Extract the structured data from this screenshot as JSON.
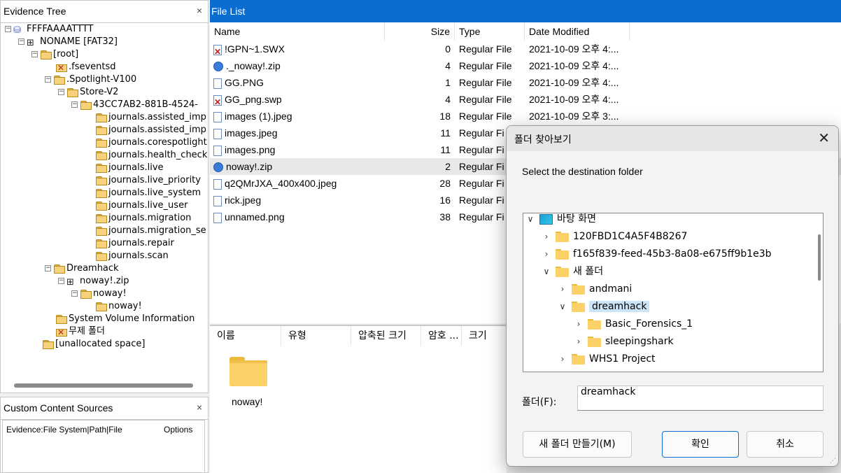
{
  "evidence_tree": {
    "title": "Evidence Tree",
    "close": "×",
    "nodes": [
      {
        "label": "FFFFAAAATTTT",
        "expander": "−",
        "icon": "disk"
      },
      {
        "label": "NONAME [FAT32]",
        "expander": "−",
        "icon": "volume"
      },
      {
        "label": "[root]",
        "expander": "−",
        "icon": "folder"
      },
      {
        "label": ".fseventsd",
        "expander": "",
        "icon": "deleted-folder"
      },
      {
        "label": ".Spotlight-V100",
        "expander": "−",
        "icon": "folder"
      },
      {
        "label": "Store-V2",
        "expander": "−",
        "icon": "folder"
      },
      {
        "label": "43CC7AB2-881B-4524-",
        "expander": "−",
        "icon": "folder"
      },
      {
        "label": "journals.assisted_imp",
        "expander": "",
        "icon": "folder"
      },
      {
        "label": "journals.assisted_imp",
        "expander": "",
        "icon": "folder"
      },
      {
        "label": "journals.corespotlight",
        "expander": "",
        "icon": "folder"
      },
      {
        "label": "journals.health_check",
        "expander": "",
        "icon": "folder"
      },
      {
        "label": "journals.live",
        "expander": "",
        "icon": "folder"
      },
      {
        "label": "journals.live_priority",
        "expander": "",
        "icon": "folder"
      },
      {
        "label": "journals.live_system",
        "expander": "",
        "icon": "folder"
      },
      {
        "label": "journals.live_user",
        "expander": "",
        "icon": "folder"
      },
      {
        "label": "journals.migration",
        "expander": "",
        "icon": "folder"
      },
      {
        "label": "journals.migration_se",
        "expander": "",
        "icon": "folder"
      },
      {
        "label": "journals.repair",
        "expander": "",
        "icon": "folder"
      },
      {
        "label": "journals.scan",
        "expander": "",
        "icon": "folder"
      },
      {
        "label": "Dreamhack",
        "expander": "−",
        "icon": "folder"
      },
      {
        "label": "noway!.zip",
        "expander": "−",
        "icon": "volume"
      },
      {
        "label": "noway!",
        "expander": "−",
        "icon": "folder"
      },
      {
        "label": "noway!",
        "expander": "",
        "icon": "folder"
      },
      {
        "label": "System Volume Information",
        "expander": "",
        "icon": "folder"
      },
      {
        "label": "무제 폴더",
        "expander": "",
        "icon": "deleted-folder"
      },
      {
        "label": "[unallocated space]",
        "expander": "",
        "icon": "folder"
      }
    ]
  },
  "custom_content_sources": {
    "title": "Custom Content Sources",
    "close": "×",
    "columns": [
      "Evidence:File System|Path|File",
      "Options"
    ]
  },
  "file_list": {
    "title": "File List",
    "columns": [
      "Name",
      "Size",
      "Type",
      "Date Modified"
    ],
    "rows": [
      {
        "name": "!GPN~1.SWX",
        "size": "0",
        "type": "Regular File",
        "date": "2021-10-09 오후 4:...",
        "icon": "deleted"
      },
      {
        "name": "._noway!.zip",
        "size": "4",
        "type": "Regular File",
        "date": "2021-10-09 오후 4:...",
        "icon": "zip"
      },
      {
        "name": "GG.PNG",
        "size": "1",
        "type": "Regular File",
        "date": "2021-10-09 오후 4:...",
        "icon": "file"
      },
      {
        "name": "GG_png.swp",
        "size": "4",
        "type": "Regular File",
        "date": "2021-10-09 오후 4:...",
        "icon": "deleted"
      },
      {
        "name": "images (1).jpeg",
        "size": "18",
        "type": "Regular File",
        "date": "2021-10-09 오후 3:...",
        "icon": "file"
      },
      {
        "name": "images.jpeg",
        "size": "11",
        "type": "Regular Fi",
        "date": "",
        "icon": "file"
      },
      {
        "name": "images.png",
        "size": "11",
        "type": "Regular Fi",
        "date": "",
        "icon": "file"
      },
      {
        "name": "noway!.zip",
        "size": "2",
        "type": "Regular Fi",
        "date": "",
        "icon": "zip",
        "selected": true
      },
      {
        "name": "q2QMrJXA_400x400.jpeg",
        "size": "28",
        "type": "Regular Fi",
        "date": "",
        "icon": "file"
      },
      {
        "name": "rick.jpeg",
        "size": "16",
        "type": "Regular Fi",
        "date": "",
        "icon": "file"
      },
      {
        "name": "unnamed.png",
        "size": "38",
        "type": "Regular Fi",
        "date": "",
        "icon": "file"
      }
    ]
  },
  "preview": {
    "columns": [
      "이름",
      "유형",
      "압축된 크기",
      "암호 ...",
      "크기"
    ],
    "item_label": "noway!"
  },
  "dialog": {
    "title": "폴더 찾아보기",
    "close": "✕",
    "prompt": "Select the destination folder",
    "tree": [
      {
        "label": "바탕 화면",
        "chevron": "∨",
        "icon": "desktop"
      },
      {
        "label": "120FBD1C4A5F4B8267",
        "chevron": "›",
        "icon": "folder"
      },
      {
        "label": "f165f839-feed-45b3-8a08-e675ff9b1e3b",
        "chevron": "›",
        "icon": "folder"
      },
      {
        "label": "새 폴더",
        "chevron": "∨",
        "icon": "folder"
      },
      {
        "label": "andmani",
        "chevron": "›",
        "icon": "folder"
      },
      {
        "label": "dreamhack",
        "chevron": "∨",
        "icon": "folder",
        "selected": true
      },
      {
        "label": "Basic_Forensics_1",
        "chevron": "›",
        "icon": "folder"
      },
      {
        "label": "sleepingshark",
        "chevron": "›",
        "icon": "folder"
      },
      {
        "label": "WHS1 Project",
        "chevron": "›",
        "icon": "folder"
      }
    ],
    "folder_label": "폴더(F):",
    "folder_value": "dreamhack",
    "new_folder_button": "새 폴더 만들기(M)",
    "ok_button": "확인",
    "cancel_button": "취소"
  },
  "colors": {
    "title_bar_blue": "#0a6ed1",
    "selection": "#cce4f7"
  }
}
